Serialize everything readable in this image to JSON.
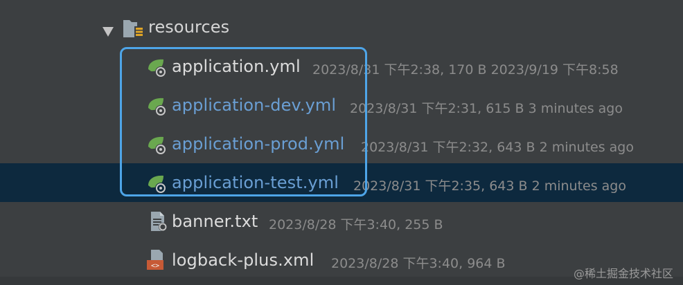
{
  "folder": {
    "name": "resources"
  },
  "files": [
    {
      "name": "application.yml",
      "meta": "2023/8/31 下午2:38, 170 B 2023/9/19 下午8:58"
    },
    {
      "name": "application-dev.yml",
      "meta": "2023/8/31 下午2:31, 615 B 3 minutes ago"
    },
    {
      "name": "application-prod.yml",
      "meta": "2023/8/31 下午2:32, 643 B 2 minutes ago"
    },
    {
      "name": "application-test.yml",
      "meta": "2023/8/31 下午2:35, 643 B 2 minutes ago"
    },
    {
      "name": "banner.txt",
      "meta": "2023/8/28 下午3:40, 255 B"
    },
    {
      "name": "logback-plus.xml",
      "meta": "2023/8/28 下午3:40, 964 B"
    }
  ],
  "watermark": "@稀土掘金技术社区",
  "colors": {
    "background": "#3c3f41",
    "selected_row": "#0d293e",
    "highlight_border": "#4ea5e8",
    "modified_file": "#6a9fd4",
    "spring_icon": "#6aa84f"
  }
}
